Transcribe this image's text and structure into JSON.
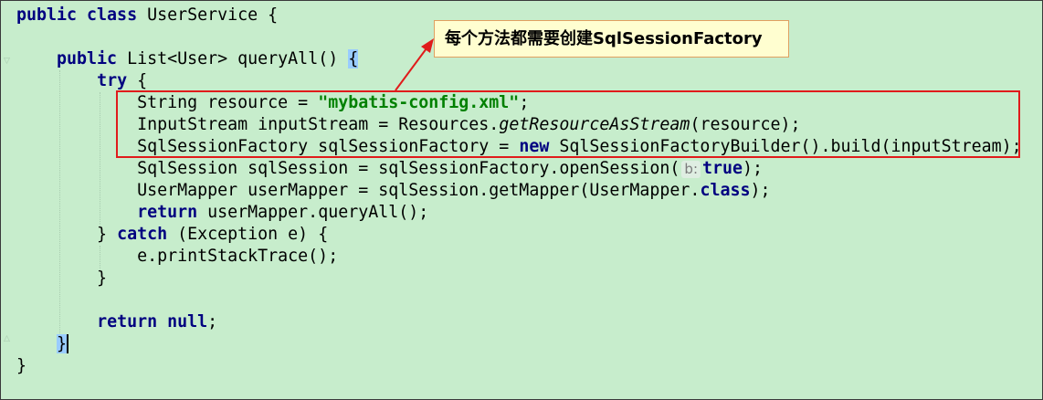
{
  "code_lines": [
    [
      {
        "t": "public class ",
        "c": "kw"
      },
      {
        "t": "UserService {"
      }
    ],
    [],
    [
      {
        "t": "    "
      },
      {
        "t": "public ",
        "c": "kw"
      },
      {
        "t": "List<User> queryAll() "
      },
      {
        "t": "{",
        "c": "brace-hl"
      }
    ],
    [
      {
        "t": "        "
      },
      {
        "t": "try ",
        "c": "kw"
      },
      {
        "t": "{"
      }
    ],
    [
      {
        "t": "            String resource = "
      },
      {
        "t": "\"mybatis-config.xml\"",
        "c": "str"
      },
      {
        "t": ";"
      }
    ],
    [
      {
        "t": "            InputStream inputStream = Resources."
      },
      {
        "t": "getResourceAsStream",
        "c": "it"
      },
      {
        "t": "(resource);"
      }
    ],
    [
      {
        "t": "            SqlSessionFactory sqlSessionFactory = "
      },
      {
        "t": "new ",
        "c": "kw"
      },
      {
        "t": "SqlSessionFactoryBuilder().build(inputStream);"
      }
    ],
    [
      {
        "t": "            SqlSession sqlSession = sqlSessionFactory.openSession("
      },
      {
        "t": "b:",
        "c": "hint"
      },
      {
        "t": "true",
        "c": "kw"
      },
      {
        "t": ");"
      }
    ],
    [
      {
        "t": "            UserMapper userMapper = sqlSession.getMapper(UserMapper."
      },
      {
        "t": "class",
        "c": "kw"
      },
      {
        "t": ");"
      }
    ],
    [
      {
        "t": "            "
      },
      {
        "t": "return ",
        "c": "kw"
      },
      {
        "t": "userMapper.queryAll();"
      }
    ],
    [
      {
        "t": "        } "
      },
      {
        "t": "catch ",
        "c": "kw"
      },
      {
        "t": "(Exception e) {"
      }
    ],
    [
      {
        "t": "            e.printStackTrace();"
      }
    ],
    [
      {
        "t": "        }"
      }
    ],
    [],
    [
      {
        "t": "        "
      },
      {
        "t": "return null",
        "c": "kw"
      },
      {
        "t": ";"
      }
    ],
    [
      {
        "t": "    "
      },
      {
        "t": "}",
        "c": "caret-brace"
      }
    ],
    [
      {
        "t": "}"
      }
    ]
  ],
  "callout": {
    "text": "每个方法都需要创建SqlSessionFactory"
  },
  "colors": {
    "editor_background": "#c7edcc",
    "keyword": "#000080",
    "string": "#008000",
    "annotation_red": "#e01b1b",
    "callout_background": "#fffed0",
    "brace_highlight": "#99ccff"
  }
}
